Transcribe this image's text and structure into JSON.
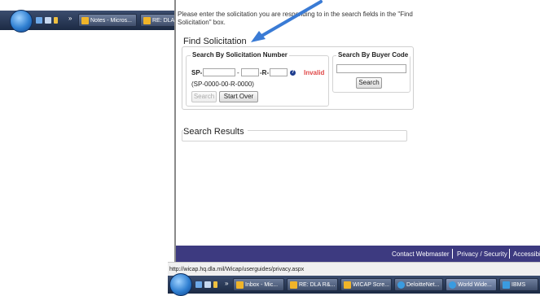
{
  "taskbar_top": {
    "items": [
      {
        "label": "Notes - Micros...",
        "color": "#f0b429"
      },
      {
        "label": "RE: DLA",
        "color": "#f0b429"
      }
    ]
  },
  "page": {
    "intro": "Please enter the solicitation you are responding to in the search fields in the \"Find Solicitation\" box.",
    "find_title": "Find Solicitation",
    "by_number": {
      "legend": "Search By Solicitation Number",
      "prefix_label": "SP-",
      "dash": "-",
      "r_label": "-R-",
      "help": "?",
      "invalid": "Invalid",
      "format_hint": "(SP-0000-00-R-0000)",
      "search_btn": "Search",
      "startover_btn": "Start Over"
    },
    "by_buyer": {
      "legend": "Search By Buyer Code",
      "search_btn": "Search"
    },
    "results_title": "Search Results",
    "footer": {
      "contact": "Contact Webmaster",
      "privacy": "Privacy / Security",
      "access": "Accessibility"
    }
  },
  "status_bar": {
    "url": "http://wicap.hq.dla.mil/Wicap/userguides/privacy.aspx"
  },
  "taskbar_bottom": {
    "items": [
      {
        "label": "Inbox - Mic...",
        "color": "#f0b429"
      },
      {
        "label": "RE: DLA R&...",
        "color": "#f0b429"
      },
      {
        "label": "WICAP Scre...",
        "color": "#f0b429"
      },
      {
        "label": "DeloitteNet...",
        "color": "#3a9be0"
      },
      {
        "label": "World Wide...",
        "color": "#3a9be0"
      },
      {
        "label": "IBMS",
        "color": "#3a9be0"
      }
    ]
  }
}
